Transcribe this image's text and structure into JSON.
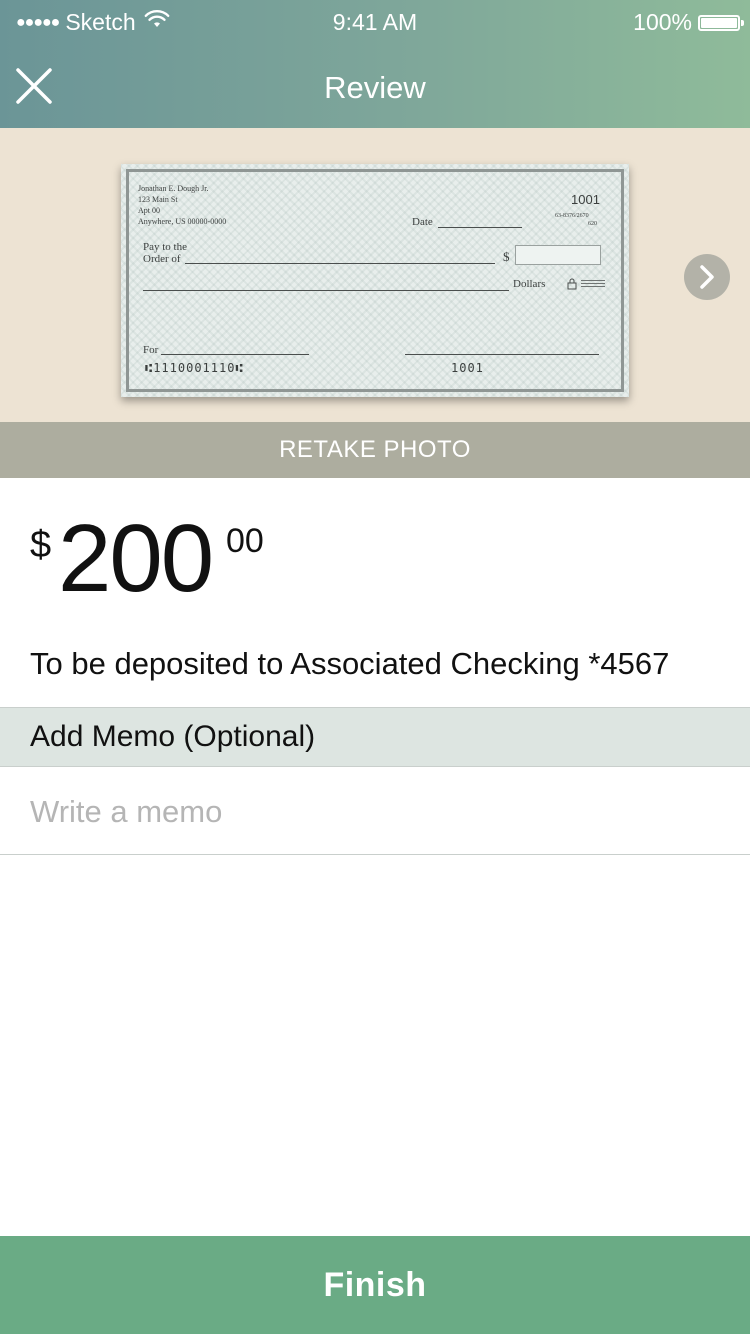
{
  "status_bar": {
    "signal": "●●●●●",
    "carrier": "Sketch",
    "time": "9:41 AM",
    "battery": "100%"
  },
  "nav": {
    "title": "Review",
    "close_icon": "close-icon"
  },
  "check_image": {
    "owner_name": "Jonathan E. Dough Jr.",
    "address_line1": "123 Main St",
    "address_line2": "Apt 00",
    "address_line3": "Anywhere, US 00000-0000",
    "check_number": "1001",
    "routing_fraction_top": "63-8376/2670",
    "routing_fraction_bottom": "620",
    "date_label": "Date",
    "pay_to_label_1": "Pay to the",
    "pay_to_label_2": "Order of",
    "dollar_sign": "$",
    "dollars_label": "Dollars",
    "for_label": "For",
    "micr_left": "⑆1110001110⑆",
    "micr_right": "1001"
  },
  "retake_label": "RETAKE PHOTO",
  "amount": {
    "currency": "$",
    "whole": "200",
    "cents": "00"
  },
  "deposit_text": "To be deposited to Associated Checking *4567",
  "memo": {
    "header": "Add Memo (Optional)",
    "placeholder": "Write a memo",
    "value": ""
  },
  "finish_label": "Finish",
  "colors": {
    "header_start": "#6b9597",
    "header_end": "#8fbb9a",
    "photo_bg": "#ede3d3",
    "retake_bg": "#adad9f",
    "memo_header_bg": "#dde5e1",
    "finish_bg": "#6aab85"
  }
}
